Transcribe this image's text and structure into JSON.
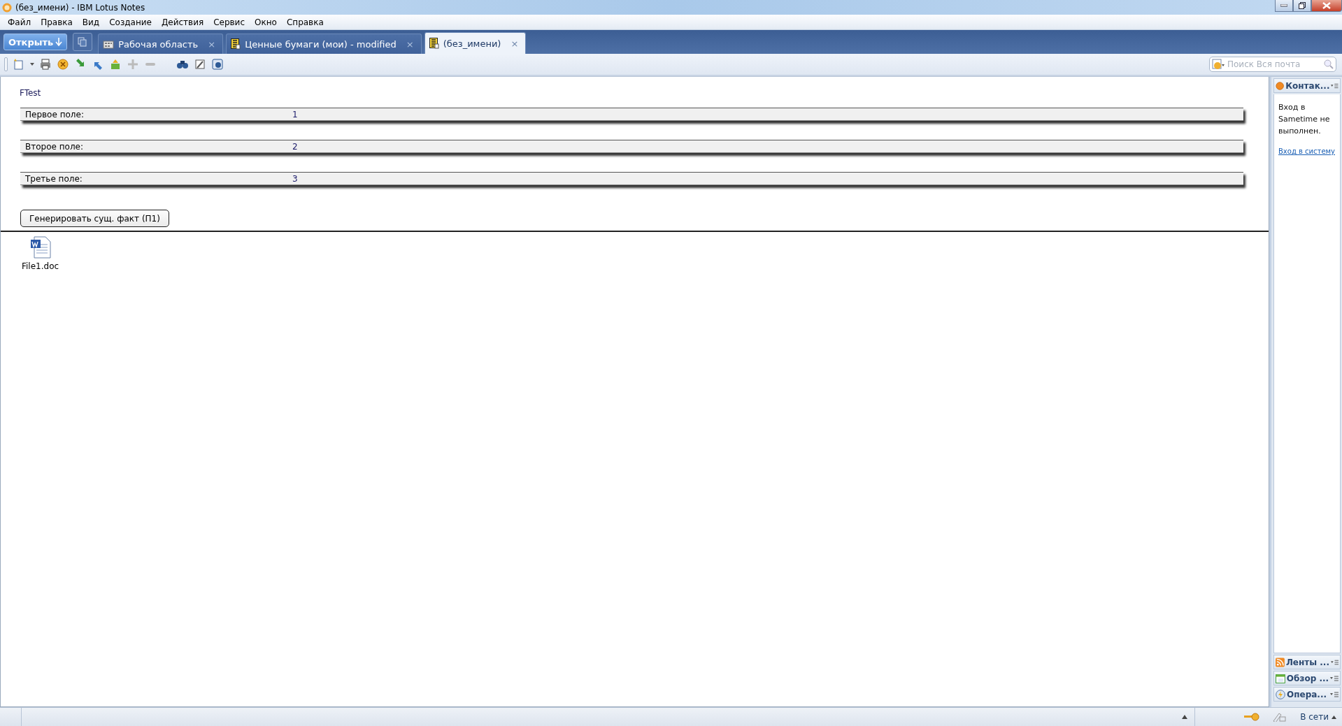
{
  "window": {
    "title": "(без_имени) - IBM Lotus Notes"
  },
  "menu": [
    "Файл",
    "Правка",
    "Вид",
    "Создание",
    "Действия",
    "Сервис",
    "Окно",
    "Справка"
  ],
  "open_button": "Открыть",
  "tabs": [
    {
      "label": "Рабочая область",
      "close": "×",
      "selected": false,
      "kind": "workspace"
    },
    {
      "label": "Ценные бумаги (мои) - modified",
      "close": "×",
      "selected": false,
      "kind": "form"
    },
    {
      "label": "(без_имени)",
      "close": "×",
      "selected": true,
      "kind": "form"
    }
  ],
  "search": {
    "placeholder": "Поиск Вся почта"
  },
  "document": {
    "title": "FTest",
    "fields": [
      {
        "label": "Первое поле:",
        "value": "1"
      },
      {
        "label": "Второе поле:",
        "value": "2"
      },
      {
        "label": "Третье поле:",
        "value": "3"
      }
    ],
    "button": "Генерировать сущ. факт (П1)",
    "attachment": "File1.doc"
  },
  "sidebar": {
    "contacts": {
      "title": "Контак...",
      "message": "Вход в Sametime не выполнен.",
      "link": "Вход в систему"
    },
    "panels": [
      {
        "title": "Ленты ...",
        "kind": "feeds"
      },
      {
        "title": "Обзор ...",
        "kind": "calendar"
      },
      {
        "title": "Опера...",
        "kind": "activities"
      }
    ]
  },
  "status_bar": {
    "status": "В сети"
  }
}
